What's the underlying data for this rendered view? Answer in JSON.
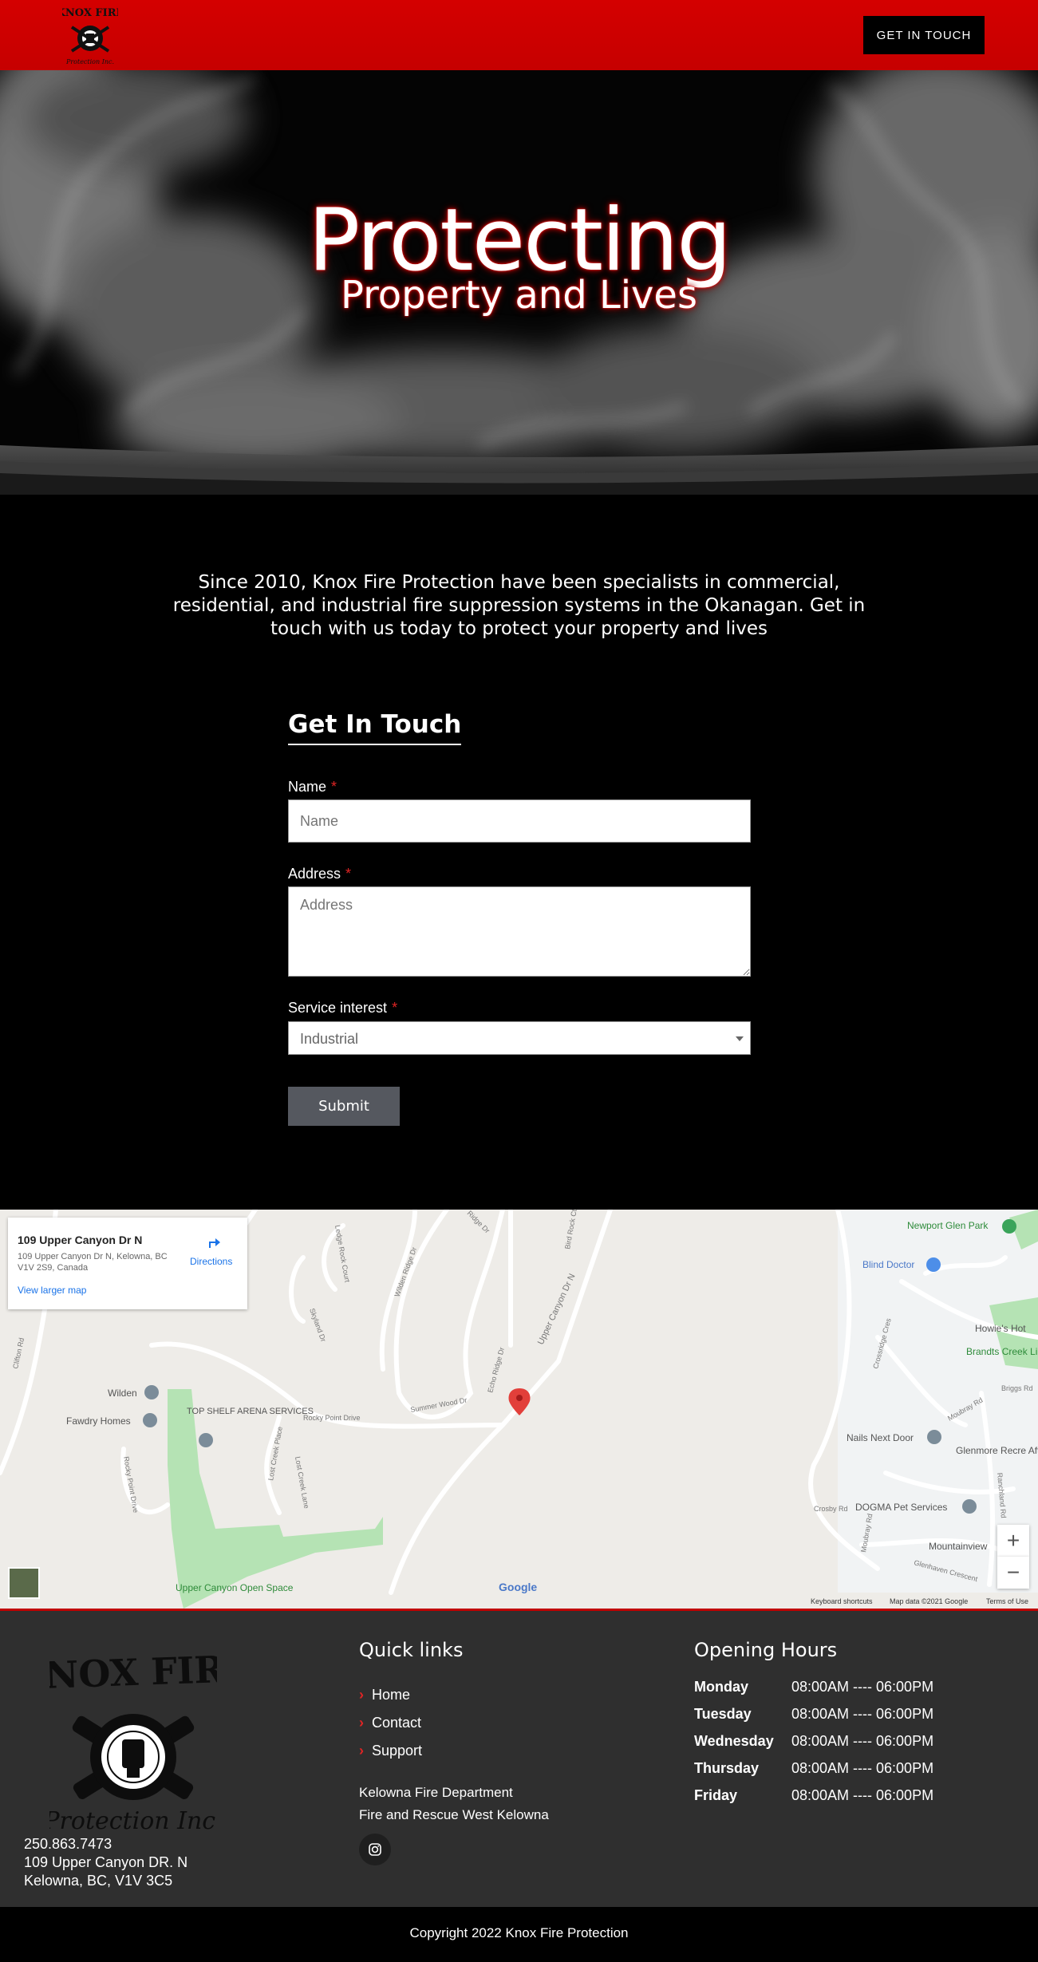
{
  "header": {
    "logo_alt": "Knox Fire Protection Inc.",
    "logo_line1": "KNOX FIRE",
    "logo_line2": "Protection Inc.",
    "cta_label": "GET IN TOUCH"
  },
  "hero": {
    "title": "Protecting",
    "subtitle": "Property and Lives"
  },
  "intro": {
    "text": "Since 2010, Knox Fire Protection have been specialists in commercial, residential, and industrial fire suppression systems in the Okanagan. Get in touch with us today to protect your property and lives"
  },
  "form": {
    "title": "Get In Touch",
    "name_label": "Name",
    "name_placeholder": "Name",
    "address_label": "Address",
    "address_placeholder": "Address",
    "service_label": "Service interest",
    "service_value": "Industrial",
    "required_mark": "*",
    "submit_label": "Submit"
  },
  "map": {
    "card_title": "109 Upper Canyon Dr N",
    "card_address": "109 Upper Canyon Dr N, Kelowna, BC V1V 2S9, Canada",
    "directions_label": "Directions",
    "larger_map_label": "View larger map",
    "zoom_in": "+",
    "zoom_out": "−",
    "google_label": "Google",
    "footer_links": [
      "Keyboard shortcuts",
      "Map data ©2021 Google",
      "Terms of Use"
    ],
    "places": [
      {
        "name": "Newport Glen Park"
      },
      {
        "name": "Blind Doctor"
      },
      {
        "name": "Howie's Hot"
      },
      {
        "name": "Brandts Creek Linear Park"
      },
      {
        "name": "Wilden"
      },
      {
        "name": "Fawdry Homes"
      },
      {
        "name": "TOP SHELF ARENA SERVICES"
      },
      {
        "name": "Nails Next Door"
      },
      {
        "name": "Glenmore Recre After School Pro"
      },
      {
        "name": "DOGMA Pet Services"
      },
      {
        "name": "Mountainview"
      },
      {
        "name": "Upper Canyon Open Space"
      }
    ],
    "streets": [
      "Clifton Rd",
      "Ledge Rock Court",
      "Skyland Dr",
      "Wilden Ridge Dr",
      "Ridge Dr",
      "Bird Rock Ct",
      "Upper Canyon Dr N",
      "Summer Wood Dr",
      "Echo Ridge Dr",
      "Rocky Point Drive",
      "Rocky Point Drive",
      "Lost Creek Place",
      "Lost Creek Lane",
      "Crosby Rd",
      "Moubray Rd",
      "Glenhaven Crescent",
      "Ranchland Rd",
      "Moubray Rd",
      "Crossridge Cres",
      "Briggs Rd"
    ]
  },
  "footer": {
    "phone": "250.863.7473",
    "street": "109 Upper Canyon DR. N",
    "city": "Kelowna, BC, V1V 3C5",
    "quick_links_title": "Quick links",
    "quick_links": [
      "Home",
      "Contact",
      "Support"
    ],
    "partners": [
      "Kelowna Fire Department",
      "Fire and Rescue West Kelowna"
    ],
    "hours_title": "Opening Hours",
    "hours": [
      {
        "day": "Monday",
        "time": "08:00AM ---- 06:00PM"
      },
      {
        "day": "Tuesday",
        "time": "08:00AM ---- 06:00PM"
      },
      {
        "day": "Wednesday",
        "time": "08:00AM ---- 06:00PM"
      },
      {
        "day": "Thursday",
        "time": "08:00AM ---- 06:00PM"
      },
      {
        "day": "Friday",
        "time": "08:00AM ---- 06:00PM"
      }
    ]
  },
  "copyright": "Copyright 2022 Knox Fire Protection"
}
